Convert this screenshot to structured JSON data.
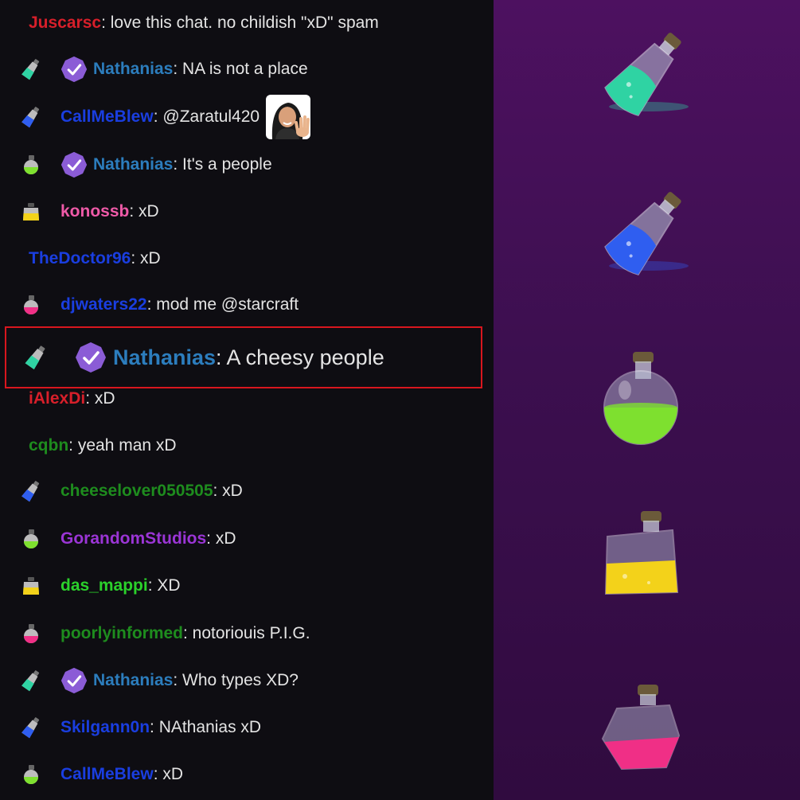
{
  "messages": [
    {
      "user": "Juscarsc",
      "text": ": love this chat. no childish \"xD\" spam",
      "color": "#d71f2a",
      "badge": "",
      "verified": false
    },
    {
      "user": "Nathanias",
      "text": ": NA is not a place",
      "color": "#2c7dbd",
      "badge": "potion-teal",
      "verified": true
    },
    {
      "user": "CallMeBlew",
      "text": ": @Zaratul420",
      "color": "#1a3ee0",
      "badge": "potion-blue",
      "verified": false,
      "emote": "waving-woman-emote"
    },
    {
      "user": "Nathanias",
      "text": ": It's a people",
      "color": "#2c7dbd",
      "badge": "potion-green",
      "verified": true
    },
    {
      "user": "konossb",
      "text": ": xD",
      "color": "#ef5aa8",
      "badge": "potion-yellow",
      "verified": false
    },
    {
      "user": "TheDoctor96",
      "text": ": xD",
      "color": "#1a3ee0",
      "badge": "",
      "verified": false
    },
    {
      "user": "djwaters22",
      "text": ": mod me @starcraft",
      "color": "#1a3ee0",
      "badge": "potion-pink",
      "verified": false
    },
    {
      "user": "Nathanias",
      "text": ": A cheesy people",
      "color": "#2c7dbd",
      "badge": "potion-teal",
      "verified": true,
      "highlighted": true
    },
    {
      "user": "iAlexDi",
      "text": ": xD",
      "color": "#d71f2a",
      "badge": "",
      "verified": false
    },
    {
      "user": "cqbn",
      "text": ": yeah man xD",
      "color": "#1e8c1e",
      "badge": "",
      "verified": false
    },
    {
      "user": "cheeselover050505",
      "text": ": xD",
      "color": "#1e8c1e",
      "badge": "potion-blue",
      "verified": false
    },
    {
      "user": "GorandomStudios",
      "text": ": xD",
      "color": "#9b35d6",
      "badge": "potion-green",
      "verified": false
    },
    {
      "user": "das_mappi",
      "text": ": XD",
      "color": "#2bd12b",
      "badge": "potion-yellow",
      "verified": false
    },
    {
      "user": "poorlyinformed",
      "text": ": notoriouis P.I.G.",
      "color": "#1e8c1e",
      "badge": "potion-pink",
      "verified": false
    },
    {
      "user": "Nathanias",
      "text": ": Who types XD?",
      "color": "#2c7dbd",
      "badge": "potion-teal",
      "verified": true
    },
    {
      "user": "Skilgann0n",
      "text": ": NAthanias xD",
      "color": "#1a3ee0",
      "badge": "potion-blue",
      "verified": false
    },
    {
      "user": "CallMeBlew",
      "text": ": xD",
      "color": "#1a3ee0",
      "badge": "potion-green",
      "verified": false
    }
  ],
  "side_potions": [
    "teal-potion-icon",
    "blue-potion-icon",
    "green-potion-icon",
    "yellow-potion-icon",
    "pink-potion-icon"
  ],
  "colors": {
    "chat_bg": "#0e0d12",
    "text": "#e4e4e4",
    "highlight_border": "#d8161e",
    "verified_badge": "#8b5cd6",
    "side_bg_top": "#4d1160",
    "side_bg_bottom": "#300b3f"
  }
}
